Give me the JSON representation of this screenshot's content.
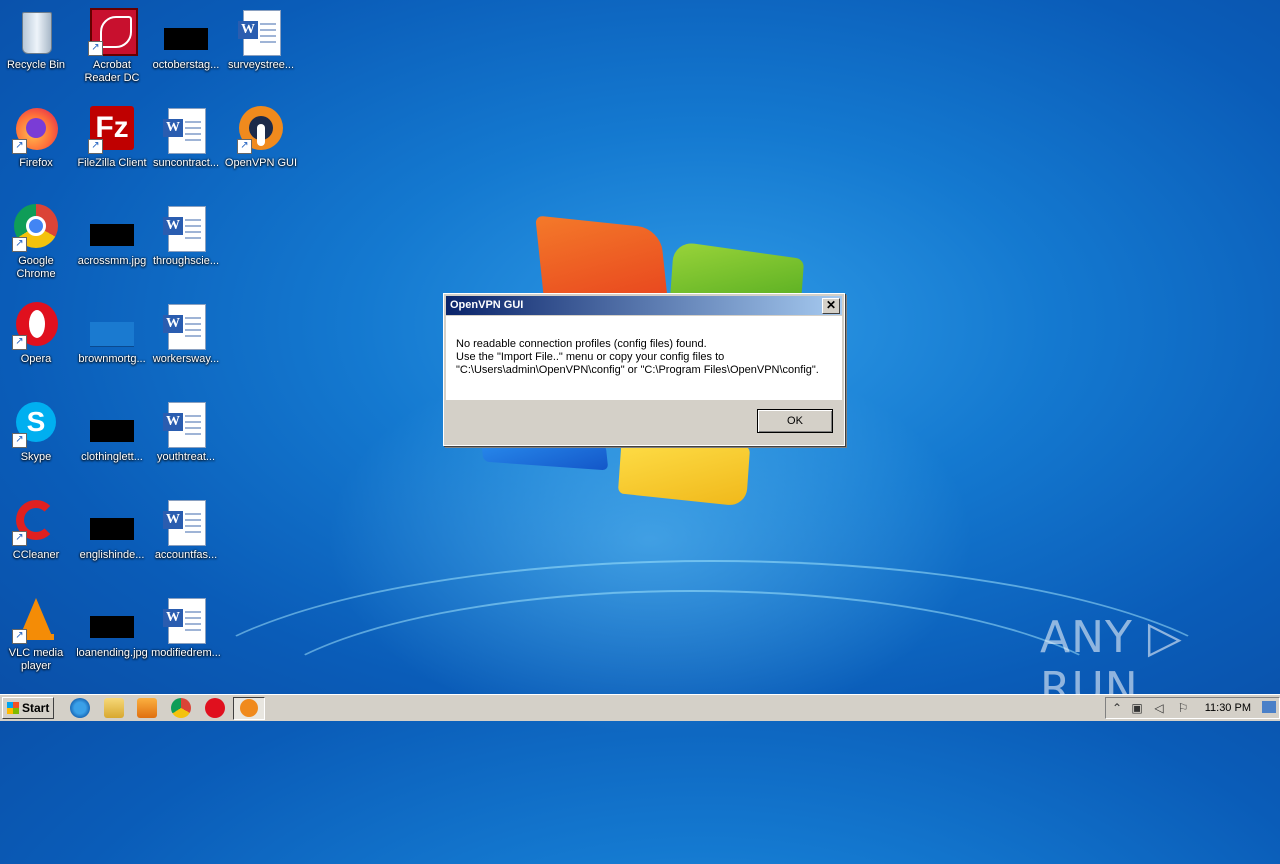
{
  "desktop": {
    "icons": [
      {
        "label": "Recycle Bin"
      },
      {
        "label": "Acrobat Reader DC"
      },
      {
        "label": "octoberstag..."
      },
      {
        "label": "surveystree..."
      },
      {
        "label": "Firefox"
      },
      {
        "label": "FileZilla Client"
      },
      {
        "label": "suncontract..."
      },
      {
        "label": "OpenVPN GUI"
      },
      {
        "label": "Google Chrome"
      },
      {
        "label": "acrossmm.jpg"
      },
      {
        "label": "throughscie..."
      },
      {
        "label": "Opera"
      },
      {
        "label": "brownmortg..."
      },
      {
        "label": "workersway..."
      },
      {
        "label": "Skype"
      },
      {
        "label": "clothinglett..."
      },
      {
        "label": "youthtreat..."
      },
      {
        "label": "CCleaner"
      },
      {
        "label": "englishinde..."
      },
      {
        "label": "accountfas..."
      },
      {
        "label": "VLC media player"
      },
      {
        "label": "loanending.jpg"
      },
      {
        "label": "modifiedrem..."
      }
    ]
  },
  "dialog": {
    "title": "OpenVPN GUI",
    "line1": "No readable connection profiles (config files) found.",
    "line2": "Use the \"Import File..\" menu or copy your config files to",
    "line3": "\"C:\\Users\\admin\\OpenVPN\\config\" or \"C:\\Program Files\\OpenVPN\\config\".",
    "ok_label": "OK",
    "close_glyph": "✕"
  },
  "taskbar": {
    "start_label": "Start",
    "clock": "11:30 PM"
  },
  "watermark": "ANY ▷ RUN"
}
